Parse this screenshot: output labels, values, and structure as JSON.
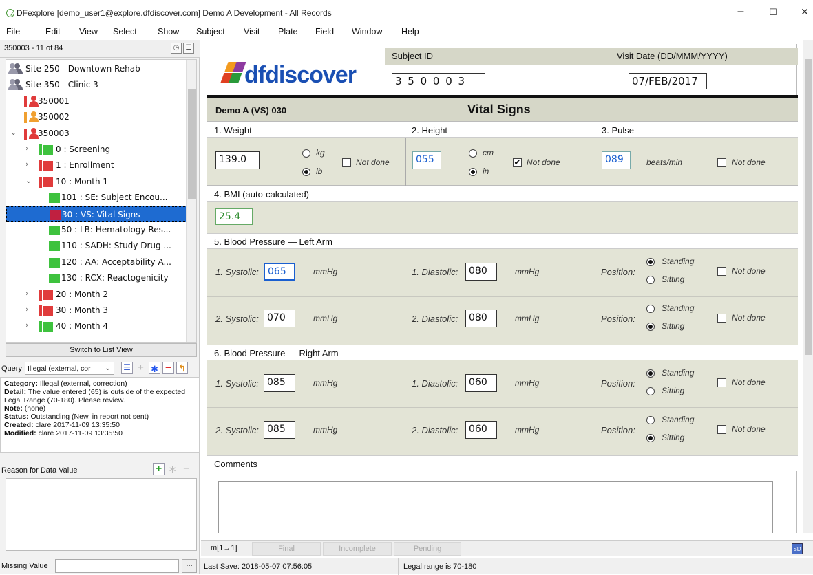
{
  "window": {
    "title": "DFexplore [demo_user1@explore.dfdiscover.com] Demo A Development - All Records",
    "minimize": "–",
    "maximize": "☐",
    "close": "✕"
  },
  "menu": [
    "File",
    "Edit",
    "View",
    "Select",
    "Show",
    "Subject",
    "Visit",
    "Plate",
    "Field",
    "Window",
    "Help"
  ],
  "nav": {
    "header": "350003 - 11 of 84",
    "tree": [
      {
        "label": "Site 250 - Downtown Rehab",
        "type": "site"
      },
      {
        "label": "Site 350 - Clinic 3",
        "type": "site"
      },
      {
        "label": "350001",
        "type": "subject",
        "color": "#e03b3b"
      },
      {
        "label": "350002",
        "type": "subject",
        "color": "#f0a030"
      },
      {
        "label": "350003",
        "type": "subject",
        "color": "#e03b3b",
        "arrow": "⌄"
      },
      {
        "label": "0 : Screening",
        "type": "visit",
        "color": "#3ec23e",
        "arrow": "›"
      },
      {
        "label": "1 : Enrollment",
        "type": "visit",
        "color": "#e03b3b",
        "arrow": "›"
      },
      {
        "label": "10 : Month 1",
        "type": "visit",
        "color": "#e03b3b",
        "arrow": "⌄"
      },
      {
        "label": "101 : SE: Subject Encou...",
        "type": "plate",
        "color": "#3ec23e"
      },
      {
        "label": "30 : VS: Vital Signs",
        "type": "plate",
        "color": "#c02040",
        "selected": true
      },
      {
        "label": "50 : LB: Hematology Res...",
        "type": "plate",
        "color": "#3ec23e"
      },
      {
        "label": "110 : SADH: Study Drug ...",
        "type": "plate",
        "color": "#3ec23e"
      },
      {
        "label": "120 : AA: Acceptability A...",
        "type": "plate",
        "color": "#3ec23e"
      },
      {
        "label": "130 : RCX: Reactogenicity",
        "type": "plate",
        "color": "#3ec23e"
      },
      {
        "label": "20 : Month 2",
        "type": "visit",
        "color": "#e03b3b",
        "arrow": "›"
      },
      {
        "label": "30 : Month 3",
        "type": "visit",
        "color": "#e03b3b",
        "arrow": "›"
      },
      {
        "label": "40 : Month 4",
        "type": "visit",
        "color": "#3ec23e",
        "arrow": "›"
      }
    ],
    "switch_view": "Switch to List View"
  },
  "query": {
    "label": "Query",
    "select_value": "Illegal (external, cor",
    "lines": [
      {
        "k": "Category:",
        "v": " Illegal (external, correction)"
      },
      {
        "k": "Detail:",
        "v": " The value entered (65) is outside of the expected Legal Range (70-180). Please review."
      },
      {
        "k": "Note:",
        "v": " (none)"
      },
      {
        "k": "Status:",
        "v": " Outstanding (New, in report not sent)"
      },
      {
        "k": "Created:",
        "v": " clare 2017-11-09 13:35:50"
      },
      {
        "k": "Modified:",
        "v": " clare 2017-11-09 13:35:50"
      }
    ]
  },
  "reason": {
    "label": "Reason for Data Value"
  },
  "missing": {
    "label": "Missing Value",
    "value": "",
    "btn": "..."
  },
  "form": {
    "logo_prefix": "df",
    "logo_suffix": "discover",
    "subject_id_label": "Subject ID",
    "subject_id": "3 5 0 0 0 3",
    "visit_date_label": "Visit Date (DD/MMM/YYYY)",
    "visit_date": "07/FEB/2017",
    "plate_code": "Demo A (VS) 030",
    "plate_title": "Vital Signs",
    "weight_label": "1. Weight",
    "height_label": "2. Height",
    "pulse_label": "3. Pulse",
    "weight": "139.0",
    "kg": "kg",
    "lb": "lb",
    "cm": "cm",
    "in": "in",
    "not_done": "Not done",
    "height": "055",
    "pulse": "089",
    "beats": "beats/min",
    "bmi_label": "4. BMI (auto-calculated)",
    "bmi": "25.4",
    "bp_left_label": "5. Blood Pressure — Left Arm",
    "bp_right_label": "6. Blood Pressure — Right Arm",
    "sys1": "1. Systolic:",
    "sys2": "2. Systolic:",
    "dia1": "1. Diastolic:",
    "dia2": "2. Diastolic:",
    "mmhg": "mmHg",
    "position": "Position:",
    "standing": "Standing",
    "sitting": "Sitting",
    "left": {
      "s1": "065",
      "d1": "080",
      "s2": "070",
      "d2": "080"
    },
    "right": {
      "s1": "085",
      "d1": "060",
      "s2": "085",
      "d2": "060"
    },
    "comments_label": "Comments"
  },
  "bottom": {
    "map": "m[1→1]",
    "final": "Final",
    "incomplete": "Incomplete",
    "pending": "Pending",
    "sd": "SD"
  },
  "status": {
    "last_save": "Last Save: 2018-05-07 07:56:05",
    "legal": "Legal range is 70-180"
  },
  "colors": {
    "accent": "#1e6bd1",
    "form_green": "#d6d7c8",
    "logo_blue": "#1a4fb3",
    "logo_orange": "#f39a1e"
  }
}
